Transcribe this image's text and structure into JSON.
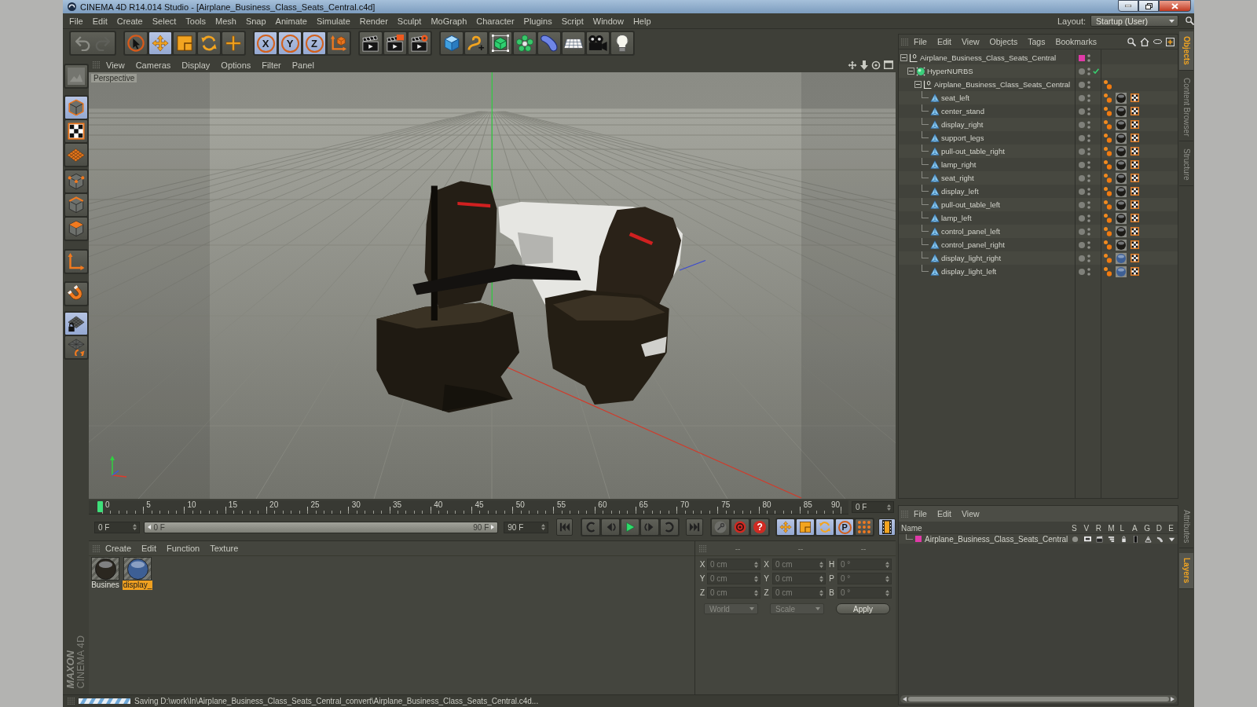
{
  "window": {
    "title": "CINEMA 4D R14.014 Studio - [Airplane_Business_Class_Seats_Central.c4d]"
  },
  "menu": [
    "File",
    "Edit",
    "Create",
    "Select",
    "Tools",
    "Mesh",
    "Snap",
    "Animate",
    "Simulate",
    "Render",
    "Sculpt",
    "MoGraph",
    "Character",
    "Plugins",
    "Script",
    "Window",
    "Help"
  ],
  "layout": {
    "label": "Layout:",
    "value": "Startup (User)"
  },
  "toolbar": {
    "groups": [
      {
        "buttons": [
          {
            "kind": "undo",
            "on": false
          }
        ]
      },
      {
        "buttons": [
          {
            "kind": "select",
            "on": false
          },
          {
            "kind": "move",
            "on": true
          },
          {
            "kind": "scale",
            "on": false
          },
          {
            "kind": "rotate",
            "on": false
          },
          {
            "kind": "add",
            "on": false
          }
        ]
      },
      {
        "buttons": [
          {
            "kind": "axis",
            "label": "X",
            "on": true
          },
          {
            "kind": "axis",
            "label": "Y",
            "on": true
          },
          {
            "kind": "axis",
            "label": "Z",
            "on": true
          },
          {
            "kind": "coords",
            "on": false
          }
        ]
      },
      {
        "buttons": [
          {
            "kind": "renderview",
            "on": false
          },
          {
            "kind": "render",
            "on": false
          },
          {
            "kind": "rendersettings",
            "on": false
          }
        ]
      },
      {
        "buttons": [
          {
            "kind": "cube",
            "on": false
          },
          {
            "kind": "spline",
            "on": false
          },
          {
            "kind": "subdivision",
            "on": false
          },
          {
            "kind": "cloner",
            "on": false
          },
          {
            "kind": "deformer",
            "on": false
          },
          {
            "kind": "floor",
            "on": false
          },
          {
            "kind": "camera",
            "on": false
          },
          {
            "kind": "light",
            "on": false
          }
        ]
      }
    ]
  },
  "side_tools": {
    "groups": [
      {
        "buttons": [
          {
            "kind": "editable",
            "on": false
          }
        ]
      },
      {
        "buttons": [
          {
            "kind": "model",
            "on": true
          },
          {
            "kind": "texture",
            "on": false
          },
          {
            "kind": "workplane",
            "on": false
          }
        ]
      },
      {
        "buttons": [
          {
            "kind": "points",
            "on": false
          },
          {
            "kind": "edges",
            "on": false
          },
          {
            "kind": "polygons",
            "on": false
          }
        ]
      },
      {
        "buttons": [
          {
            "kind": "axis",
            "on": false
          }
        ]
      },
      {
        "buttons": [
          {
            "kind": "snap",
            "on": false
          }
        ]
      },
      {
        "buttons": [
          {
            "kind": "lock",
            "on": true
          },
          {
            "kind": "planar",
            "on": false
          }
        ]
      }
    ]
  },
  "logo": {
    "title": "MAXON",
    "subtitle": "CINEMA 4D"
  },
  "viewport": {
    "menu": [
      "View",
      "Cameras",
      "Display",
      "Options",
      "Filter",
      "Panel"
    ],
    "label": "Perspective"
  },
  "timeline": {
    "frames": [
      "0",
      "5",
      "10",
      "15",
      "20",
      "25",
      "30",
      "35",
      "40",
      "45",
      "50",
      "55",
      "60",
      "65",
      "70",
      "75",
      "80",
      "85",
      "90"
    ],
    "level": 0,
    "current": "0 F",
    "start": "0 F",
    "range_start": "0 F",
    "range_end": "90 F",
    "end": "90 F",
    "record": [
      {
        "kind": "key"
      },
      {
        "kind": "autokey"
      },
      {
        "kind": "help",
        "label": "?"
      }
    ],
    "filters": [
      {
        "kind": "move",
        "on": true
      },
      {
        "kind": "scale",
        "on": true
      },
      {
        "kind": "rotate",
        "on": true
      },
      {
        "kind": "param",
        "label": "P",
        "on": true
      },
      {
        "kind": "points",
        "on": false
      }
    ],
    "timeline_button": {
      "on": true
    }
  },
  "materials": {
    "menu": [
      "Create",
      "Edit",
      "Function",
      "Texture"
    ],
    "items": [
      {
        "name": "Busines",
        "color": "#2b2720",
        "selected": false
      },
      {
        "name": "display_",
        "color": "#3d5f95",
        "selected": true
      }
    ]
  },
  "coords": {
    "headers": [
      "--",
      "--",
      "--"
    ],
    "rows": [
      {
        "axis": "X",
        "position": "0 cm",
        "size_axis": "X",
        "size": "0 cm",
        "rot_axis": "H",
        "rotation": "0 °"
      },
      {
        "axis": "Y",
        "position": "0 cm",
        "size_axis": "Y",
        "size": "0 cm",
        "rot_axis": "P",
        "rotation": "0 °"
      },
      {
        "axis": "Z",
        "position": "0 cm",
        "size_axis": "Z",
        "size": "0 cm",
        "rot_axis": "B",
        "rotation": "0 °"
      }
    ],
    "mode": "World",
    "size_mode": "Scale",
    "apply": "Apply"
  },
  "objects": {
    "menu": [
      "File",
      "Edit",
      "View",
      "Objects",
      "Tags",
      "Bookmarks"
    ],
    "tree": [
      {
        "name": "Airplane_Business_Class_Seats_Central",
        "kind": "null",
        "expanded": true,
        "color": "#e03aa8",
        "children": [
          {
            "name": "HyperNURBS",
            "kind": "hypernurbs",
            "expanded": true,
            "enabled": true,
            "children": [
              {
                "name": "Airplane_Business_Class_Seats_Central",
                "kind": "null",
                "expanded": true,
                "tags": [
                  {
                    "kind": "phong"
                  }
                ],
                "children": [
                  {
                    "name": "seat_left",
                    "kind": "polygon",
                    "tags": [
                      {
                        "kind": "phong"
                      },
                      {
                        "kind": "material",
                        "color": "#1c1a16"
                      },
                      {
                        "kind": "uvw"
                      }
                    ]
                  },
                  {
                    "name": "center_stand",
                    "kind": "polygon",
                    "tags": [
                      {
                        "kind": "phong"
                      },
                      {
                        "kind": "material",
                        "color": "#1c1a16"
                      },
                      {
                        "kind": "uvw"
                      }
                    ]
                  },
                  {
                    "name": "display_right",
                    "kind": "polygon",
                    "tags": [
                      {
                        "kind": "phong"
                      },
                      {
                        "kind": "material",
                        "color": "#1c1a16"
                      },
                      {
                        "kind": "uvw"
                      }
                    ]
                  },
                  {
                    "name": "support_legs",
                    "kind": "polygon",
                    "tags": [
                      {
                        "kind": "phong"
                      },
                      {
                        "kind": "material",
                        "color": "#1c1a16"
                      },
                      {
                        "kind": "uvw"
                      }
                    ]
                  },
                  {
                    "name": "pull-out_table_right",
                    "kind": "polygon",
                    "tags": [
                      {
                        "kind": "phong"
                      },
                      {
                        "kind": "material",
                        "color": "#1c1a16"
                      },
                      {
                        "kind": "uvw"
                      }
                    ]
                  },
                  {
                    "name": "lamp_right",
                    "kind": "polygon",
                    "tags": [
                      {
                        "kind": "phong"
                      },
                      {
                        "kind": "material",
                        "color": "#1c1a16"
                      },
                      {
                        "kind": "uvw"
                      }
                    ]
                  },
                  {
                    "name": "seat_right",
                    "kind": "polygon",
                    "tags": [
                      {
                        "kind": "phong"
                      },
                      {
                        "kind": "material",
                        "color": "#1c1a16"
                      },
                      {
                        "kind": "uvw"
                      }
                    ]
                  },
                  {
                    "name": "display_left",
                    "kind": "polygon",
                    "tags": [
                      {
                        "kind": "phong"
                      },
                      {
                        "kind": "material",
                        "color": "#1c1a16"
                      },
                      {
                        "kind": "uvw"
                      }
                    ]
                  },
                  {
                    "name": "pull-out_table_left",
                    "kind": "polygon",
                    "tags": [
                      {
                        "kind": "phong"
                      },
                      {
                        "kind": "material",
                        "color": "#1c1a16"
                      },
                      {
                        "kind": "uvw"
                      }
                    ]
                  },
                  {
                    "name": "lamp_left",
                    "kind": "polygon",
                    "tags": [
                      {
                        "kind": "phong"
                      },
                      {
                        "kind": "material",
                        "color": "#1c1a16"
                      },
                      {
                        "kind": "uvw"
                      }
                    ]
                  },
                  {
                    "name": "control_panel_left",
                    "kind": "polygon",
                    "tags": [
                      {
                        "kind": "phong"
                      },
                      {
                        "kind": "material",
                        "color": "#1c1a16"
                      },
                      {
                        "kind": "uvw"
                      }
                    ]
                  },
                  {
                    "name": "control_panel_right",
                    "kind": "polygon",
                    "tags": [
                      {
                        "kind": "phong"
                      },
                      {
                        "kind": "material",
                        "color": "#1c1a16"
                      },
                      {
                        "kind": "uvw"
                      }
                    ]
                  },
                  {
                    "name": "display_light_right",
                    "kind": "polygon",
                    "tags": [
                      {
                        "kind": "phong"
                      },
                      {
                        "kind": "material",
                        "color": "#3d5f95"
                      },
                      {
                        "kind": "uvw"
                      }
                    ]
                  },
                  {
                    "name": "display_light_left",
                    "kind": "polygon",
                    "tags": [
                      {
                        "kind": "phong"
                      },
                      {
                        "kind": "material",
                        "color": "#3d5f95"
                      },
                      {
                        "kind": "uvw"
                      }
                    ]
                  }
                ]
              }
            ]
          }
        ]
      }
    ]
  },
  "tabs": {
    "top": [
      {
        "label": "Objects",
        "selected": true
      },
      {
        "label": "Content Browser",
        "selected": false
      },
      {
        "label": "Structure",
        "selected": false
      }
    ],
    "bottom": [
      {
        "label": "Attributes",
        "selected": false
      },
      {
        "label": "Layers",
        "selected": true
      }
    ]
  },
  "layers": {
    "menu": [
      "File",
      "Edit",
      "View"
    ],
    "columns": [
      "Name",
      "S",
      "V",
      "R",
      "M",
      "L",
      "A",
      "G",
      "D",
      "E"
    ],
    "rows": [
      {
        "name": "Airplane_Business_Class_Seats_Central",
        "color": "#e03aa8"
      }
    ]
  },
  "status": {
    "text": "Saving D:\\work\\In\\Airplane_Business_Class_Seats_Central_convert\\Airplane_Business_Class_Seats_Central.c4d..."
  }
}
